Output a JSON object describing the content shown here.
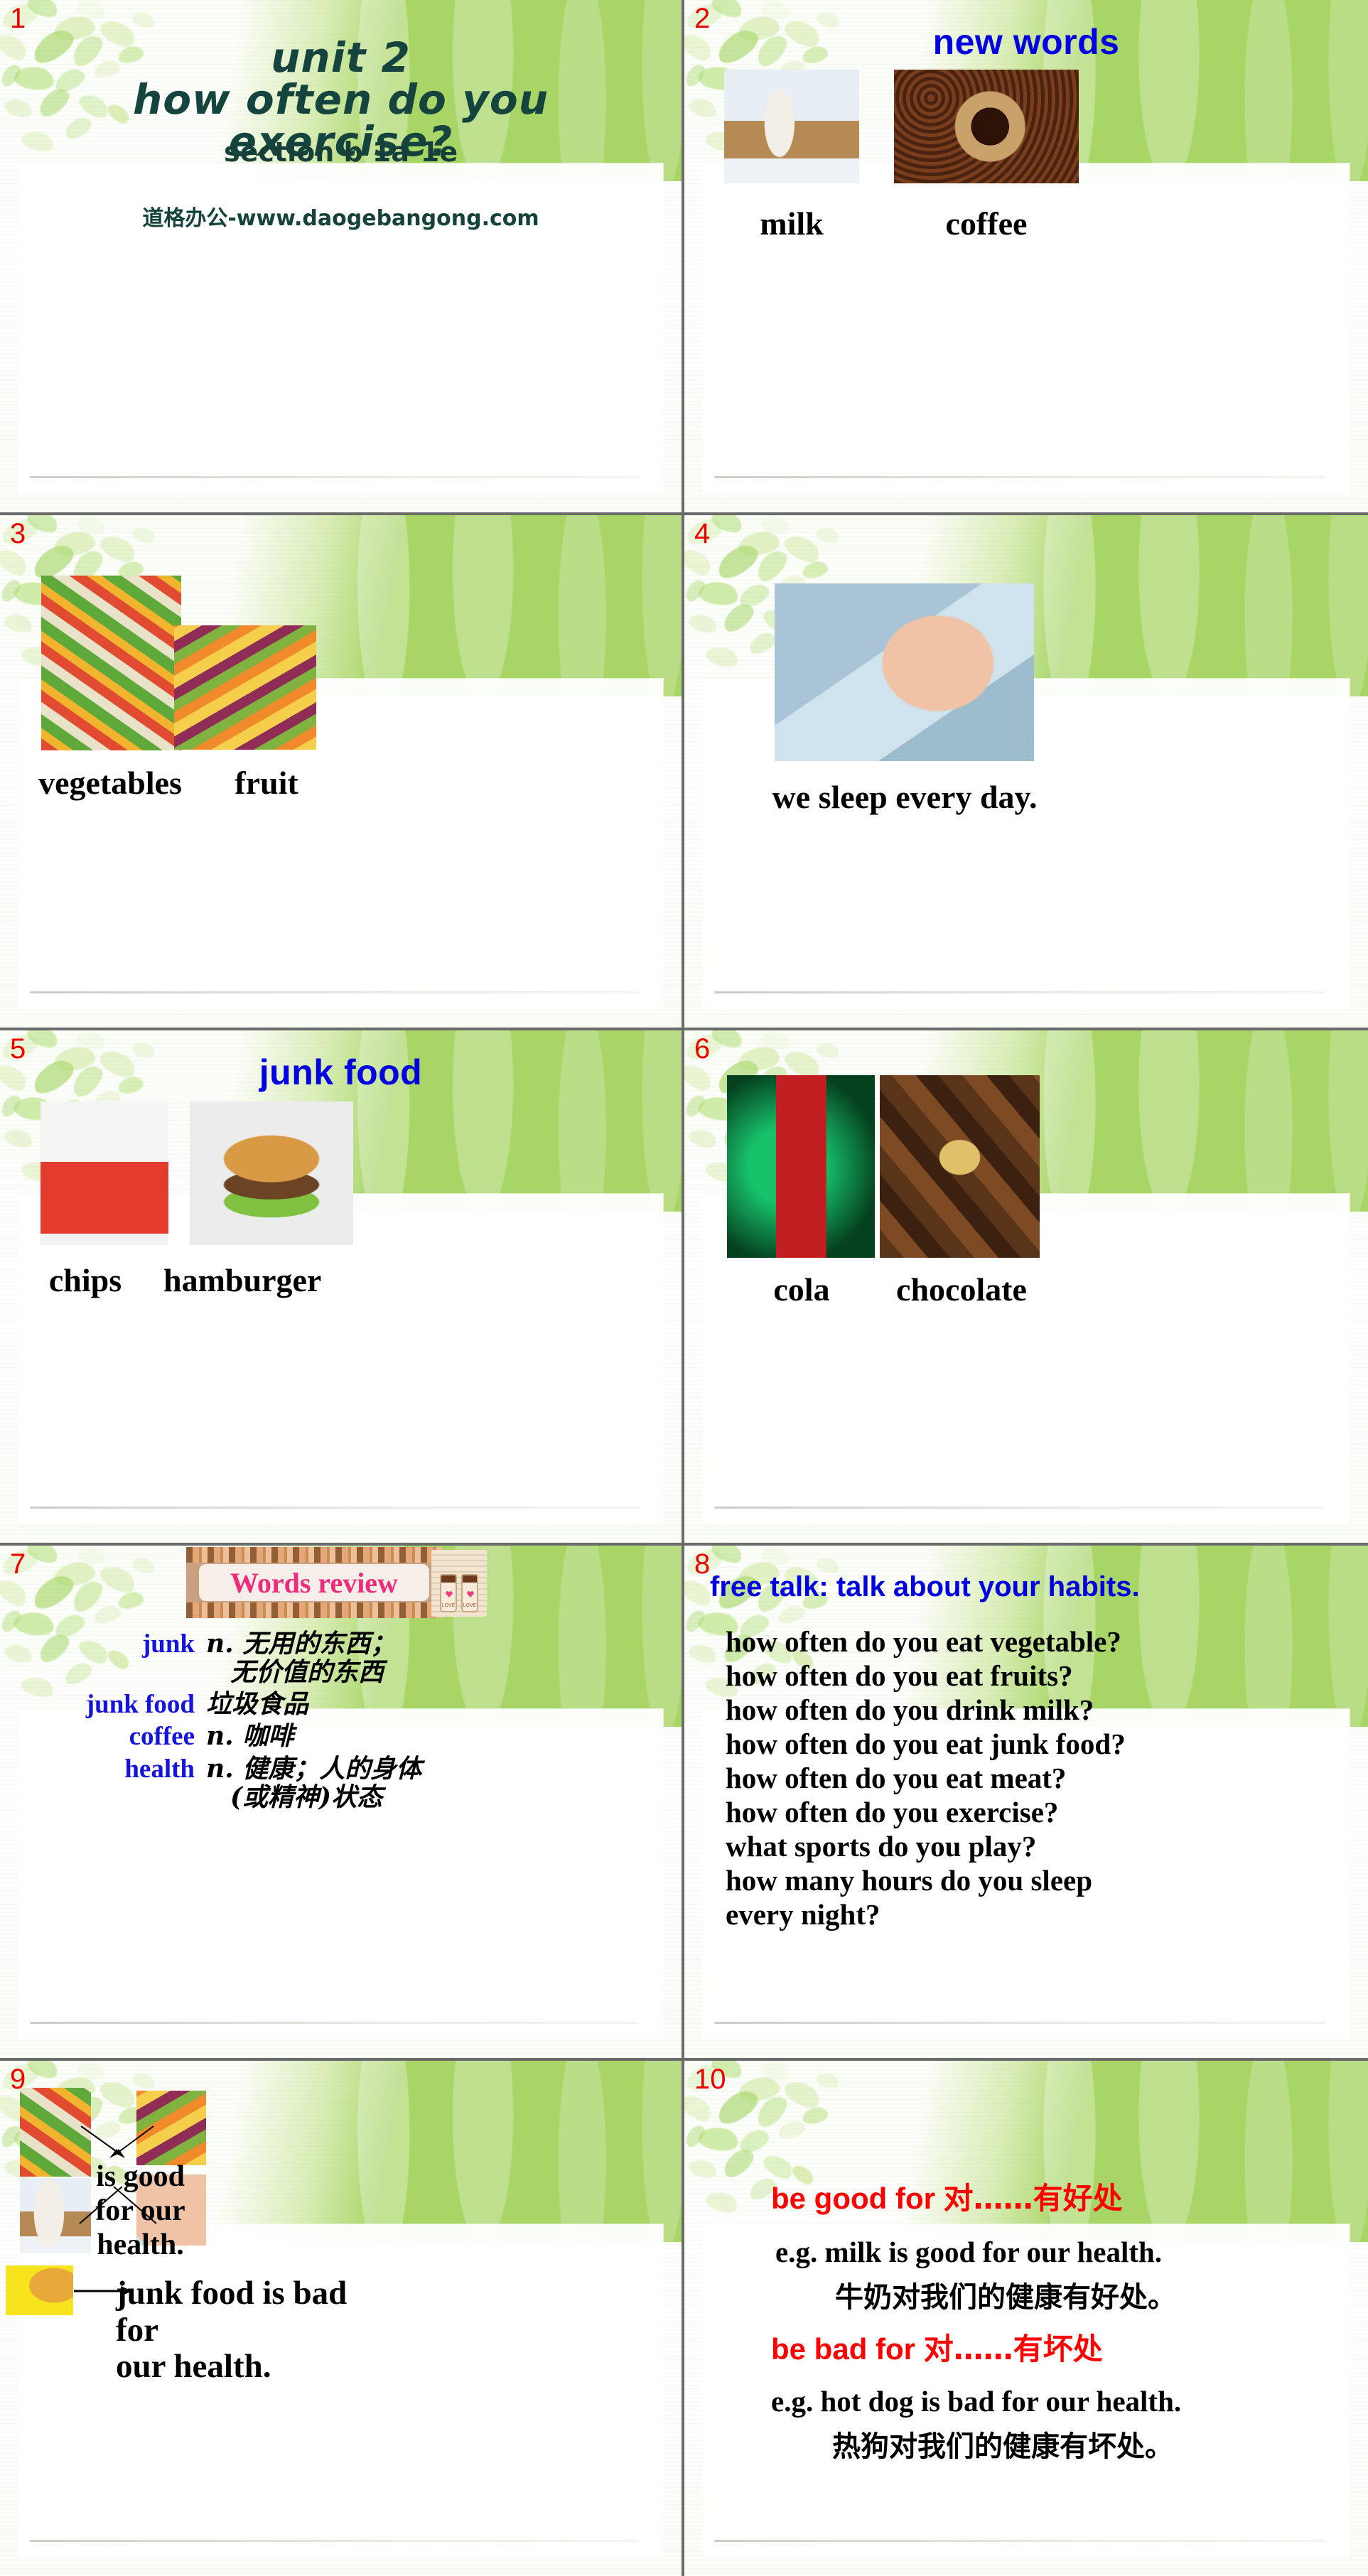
{
  "deck": {
    "page_numbers": [
      "1",
      "2",
      "3",
      "4",
      "5",
      "6",
      "7",
      "8",
      "9",
      "10"
    ]
  },
  "slide1": {
    "title_line1": "unit 2",
    "title_line2": "how often do you",
    "title_line3": "exercise?",
    "subtitle": "section b 1a-1e",
    "website": "道格办公-www.daogebangong.com"
  },
  "slide2": {
    "heading": "new words",
    "caption_left": "milk",
    "caption_right": "coffee",
    "image_left": "glass-of-milk-photo",
    "image_right": "cup-of-coffee-photo"
  },
  "slide3": {
    "caption_left": "vegetables",
    "caption_right": "fruit",
    "image_left": "assorted-vegetables-photo",
    "image_right": "assorted-fruit-photo"
  },
  "slide4": {
    "caption": "we sleep every day.",
    "image": "sleeping-child-photo"
  },
  "slide5": {
    "heading": "junk food",
    "caption_left": "chips",
    "caption_right": "hamburger",
    "image_left": "french-fries-photo",
    "image_right": "hamburger-photo"
  },
  "slide6": {
    "caption_left": "cola",
    "caption_right": "chocolate",
    "image_left": "coca-cola-can-poster",
    "image_right": "chocolates-photo"
  },
  "slide7": {
    "banner_title": "Words review",
    "entries": [
      {
        "word": "junk",
        "def_line1": "n. 无用的东西；",
        "def_line2": "无价值的东西"
      },
      {
        "word": "junk food",
        "def_line1": "垃圾食品",
        "def_line2": ""
      },
      {
        "word": "coffee",
        "def_line1": "n. 咖啡",
        "def_line2": ""
      },
      {
        "word": "health",
        "def_line1": "n. 健康；人的身体",
        "def_line2": "(或精神)状态"
      }
    ]
  },
  "slide8": {
    "heading": "free talk: talk about your habits.",
    "questions": [
      "how often do you eat vegetable?",
      "how often do you eat fruits?",
      "how often do you drink milk?",
      "how often do you eat junk food?",
      "how often do you eat meat?",
      "how often do you exercise?",
      "what sports do you play?",
      "how many hours do you sleep",
      "every night?"
    ]
  },
  "slide9": {
    "center_text_line1": "is good",
    "center_text_line2": "for our",
    "center_text_line3": "health.",
    "bottom_text_line1": "junk food is bad for",
    "bottom_text_line2": "our health.",
    "images": [
      "vegetables-photo",
      "fruit-photo",
      "milk-photo",
      "sleeping-child-photo",
      "junk-food-ad-photo"
    ]
  },
  "slide10": {
    "phrase_good_en": "be good for",
    "phrase_good_cn": "对……有好处",
    "example_good_en": "e.g. milk is good for our health.",
    "example_good_cn": "牛奶对我们的健康有好处。",
    "phrase_bad_en": "be bad for",
    "phrase_bad_cn": "对……有坏处",
    "example_bad_en": "e.g. hot dog is bad for our health.",
    "example_bad_cn": "热狗对我们的健康有坏处。"
  },
  "colors": {
    "green_band": "#a7d566",
    "page_number": "#ee0000",
    "heading_blue": "#0000e0",
    "word_blue": "#1414dc",
    "banner_pink": "#ef2b7b",
    "red_phrase": "#ff0000",
    "title_dark_green": "#15443f"
  }
}
